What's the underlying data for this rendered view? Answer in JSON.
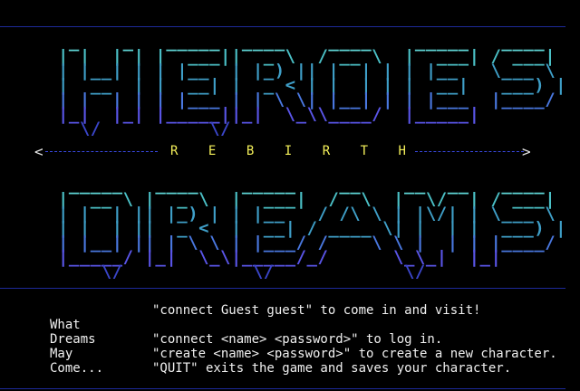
{
  "banner": {
    "title_top": "HEROES",
    "title_bottom": "DREAMS",
    "subtitle_letters": [
      "R",
      "E",
      "B",
      "I",
      "R",
      "T",
      "H"
    ],
    "colors": {
      "border": "#1d2a9a",
      "subtitle": "#f4f05a",
      "art_top": "#5fd6d6",
      "art_bottom": "#3a45c8"
    }
  },
  "art": {
    "heroes": [
      "  _    _   _____  ____    ____    _____   ____  ",
      " | |  | | |  ___||  _ \\  / __ \\  |  ___| / ___| ",
      " | |__| | | |__  | |_) || |  | | | |__   \\___ \\ ",
      " |  __  | |  __| |  _ < | |  | | |  __|   ___) |",
      " | |  | | | |___ | | \\ \\| |__| | | |___  |____/ ",
      " |_|  |_| |_____||_|  \\_\\\\____/  |_____|        ",
      "   \\/          \\/                               "
    ],
    "dreams": [
      "  _____   ____    _____    __    __  __   ____  ",
      " |  __ \\ |  _ \\  |  ___|  /  \\  |  \\/  | / ___| ",
      " | |  | || |_) | | |__   / /\\ \\ | |\\/| | \\___ \\ ",
      " | |  | ||  _ <  |  __| / ____ \\| |  | |  ___) |",
      " | |__| || | \\ \\ | |___/ /    \\ \\ |  | | |____/ ",
      " |_____/ |_|  \\_\\|_____/_/      \\_\\_|  |_|      ",
      "     \\/            \\/            \\/             "
    ]
  },
  "left_words": [
    "What",
    "Dreams",
    "May",
    "Come..."
  ],
  "commands": [
    "\"connect Guest guest\" to come in and visit!",
    "",
    "\"connect <name> <password>\" to log in.",
    "\"create  <name> <password>\" to create a new character.",
    "\"QUIT\" exits the game and saves your character."
  ]
}
